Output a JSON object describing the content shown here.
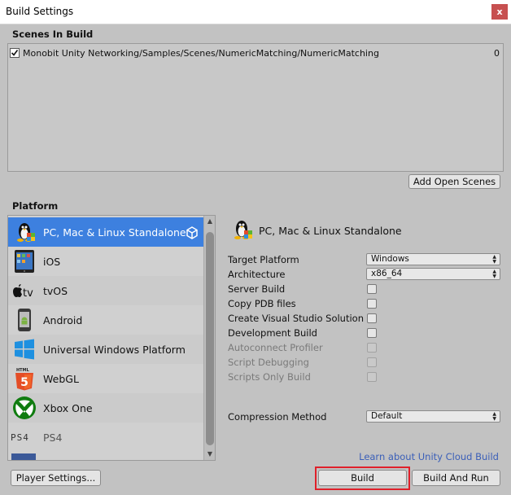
{
  "window": {
    "title": "Build Settings",
    "close_glyph": "x"
  },
  "scenes": {
    "header": "Scenes In Build",
    "items": [
      {
        "checked": true,
        "path": "Monobit Unity Networking/Samples/Scenes/NumericMatching/NumericMatching",
        "index": "0"
      }
    ],
    "add_open_scenes": "Add Open Scenes"
  },
  "platform": {
    "header": "Platform",
    "items": [
      {
        "label": "PC, Mac & Linux Standalone",
        "icon": "tux-icon",
        "selected": true
      },
      {
        "label": "iOS",
        "icon": "ipad-icon"
      },
      {
        "label": "tvOS",
        "icon": "apple-tv-icon"
      },
      {
        "label": "Android",
        "icon": "android-phone-icon"
      },
      {
        "label": "Universal Windows Platform",
        "icon": "windows-logo-icon"
      },
      {
        "label": "WebGL",
        "icon": "html5-icon"
      },
      {
        "label": "Xbox One",
        "icon": "xbox-logo-icon"
      },
      {
        "label": "PS4",
        "icon": "ps4-logo-icon"
      }
    ],
    "tvos_prefix": "tv",
    "ps4_logo": "PS4",
    "html_tag": "HTML",
    "html_five": "5"
  },
  "settings": {
    "selected_platform": "PC, Mac & Linux Standalone",
    "target_platform": {
      "label": "Target Platform",
      "value": "Windows"
    },
    "architecture": {
      "label": "Architecture",
      "value": "x86_64"
    },
    "server_build": "Server Build",
    "copy_pdb": "Copy PDB files",
    "create_vs_solution": "Create Visual Studio Solution",
    "development_build": "Development Build",
    "autoconnect_profiler": "Autoconnect Profiler",
    "script_debugging": "Script Debugging",
    "scripts_only_build": "Scripts Only Build",
    "compression": {
      "label": "Compression Method",
      "value": "Default"
    }
  },
  "footer": {
    "cloud_build_link": "Learn about Unity Cloud Build",
    "player_settings": "Player Settings...",
    "build": "Build",
    "build_and_run": "Build And Run"
  },
  "colors": {
    "selection": "#3d80df",
    "highlight_outline": "#e0202a",
    "link": "#3b5fb8",
    "panel": "#c2c2c2"
  }
}
